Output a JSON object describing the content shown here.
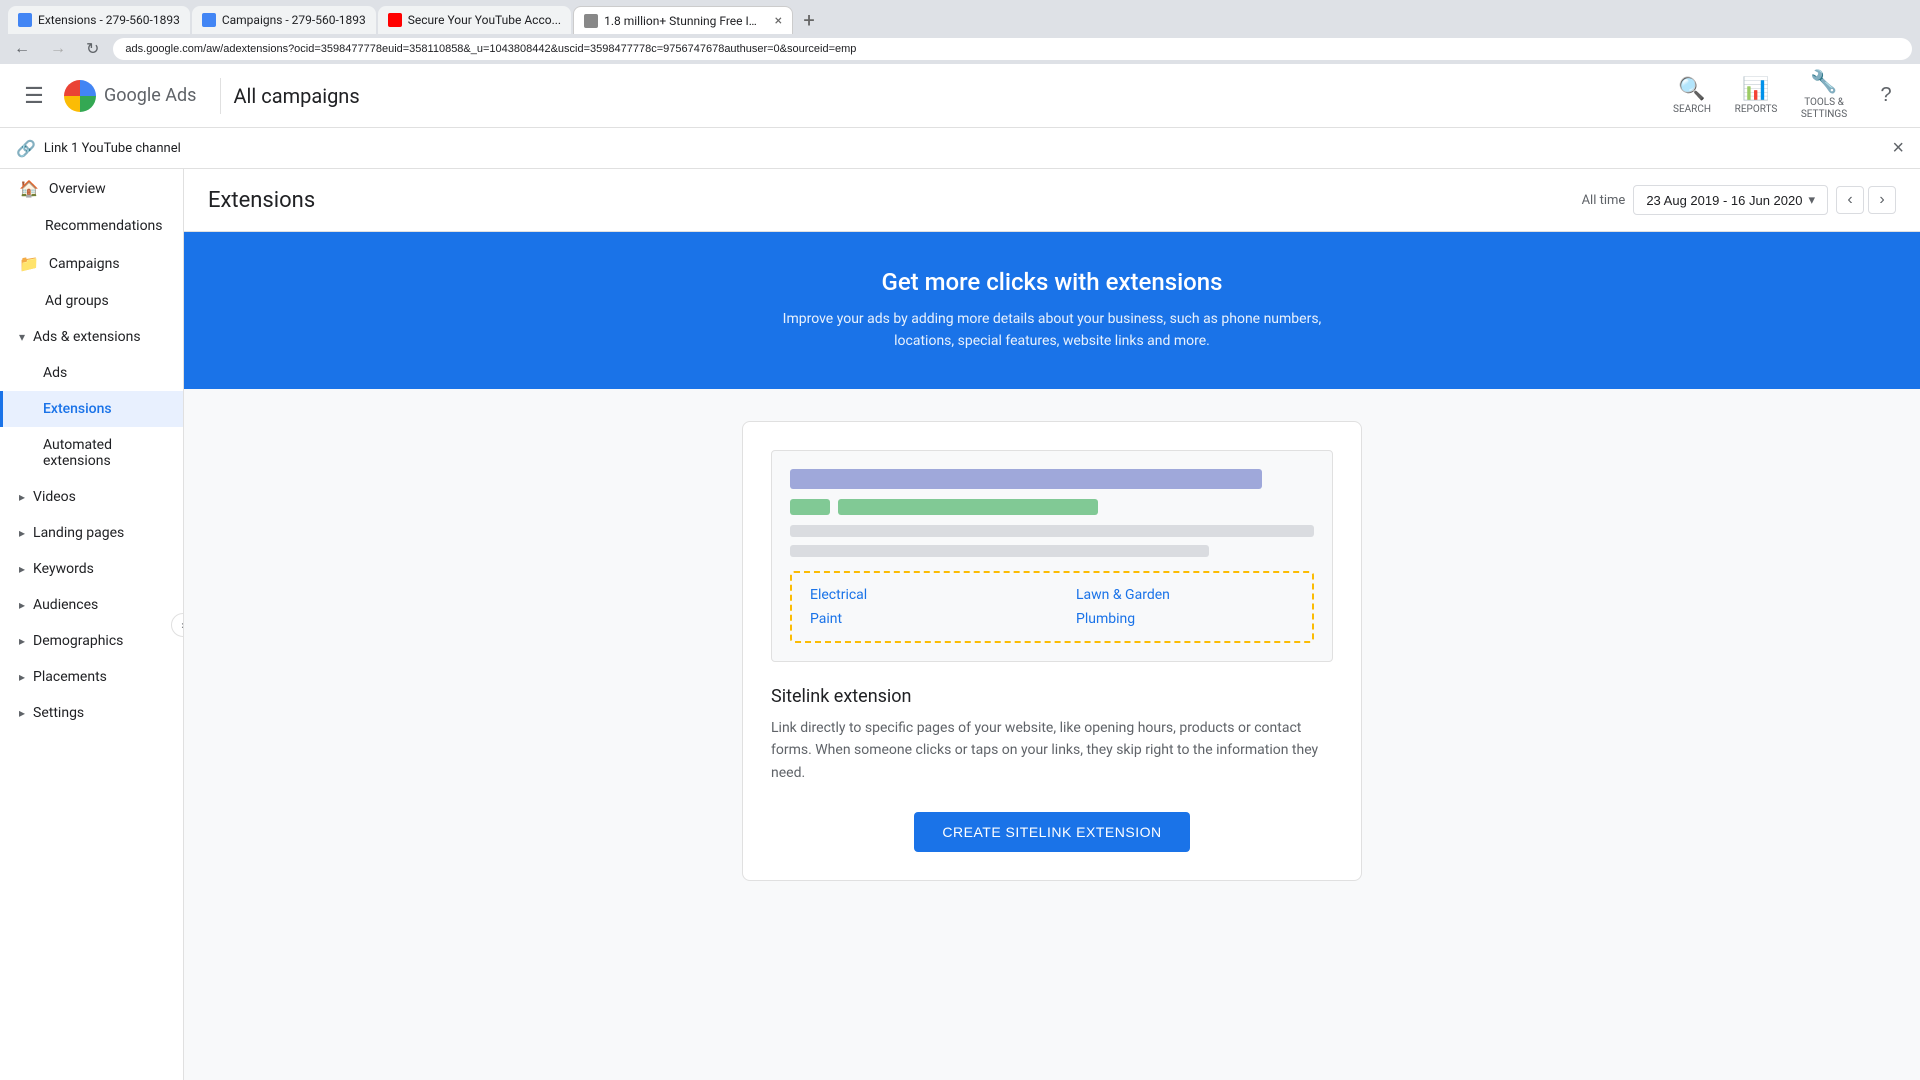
{
  "browser": {
    "address_bar": "ads.google.com/aw/adextensions?ocid=3598477778euid=358110858&_u=1043808442&uscid=3598477778c=9756747678authuser=0&sourceid=emp",
    "tabs": [
      {
        "id": "tab1",
        "label": "Extensions - 279-560-1893",
        "favicon_type": "google-ads",
        "active": false
      },
      {
        "id": "tab2",
        "label": "Campaigns - 279-560-1893",
        "favicon_type": "campaigns",
        "active": false
      },
      {
        "id": "tab3",
        "label": "Secure Your YouTube Acco...",
        "favicon_type": "youtube",
        "active": false
      },
      {
        "id": "tab4",
        "label": "1.8 million+ Stunning Free Im...",
        "favicon_type": "external",
        "active": true
      }
    ]
  },
  "notification_bar": {
    "text": "Link 1 YouTube channel",
    "close_label": "×"
  },
  "header": {
    "app_name": "Google Ads",
    "campaign_label": "All campaigns",
    "search_label": "SEARCH",
    "reports_label": "REPORTS",
    "tools_label": "TOOLS & SETTINGS"
  },
  "sidebar": {
    "items": [
      {
        "id": "overview",
        "label": "Overview",
        "icon": "🏠",
        "has_icon": true,
        "level": "top"
      },
      {
        "id": "recommendations",
        "label": "Recommendations",
        "icon": "",
        "level": "top"
      },
      {
        "id": "campaigns",
        "label": "Campaigns",
        "icon": "🏠",
        "has_icon": true,
        "level": "top"
      },
      {
        "id": "ad-groups",
        "label": "Ad groups",
        "icon": "",
        "level": "top"
      },
      {
        "id": "ads-extensions",
        "label": "Ads & extensions",
        "icon": "",
        "level": "group",
        "expanded": true
      },
      {
        "id": "ads",
        "label": "Ads",
        "icon": "",
        "level": "sub"
      },
      {
        "id": "extensions",
        "label": "Extensions",
        "icon": "",
        "level": "sub",
        "active": true
      },
      {
        "id": "automated-extensions",
        "label": "Automated extensions",
        "icon": "",
        "level": "sub"
      },
      {
        "id": "videos",
        "label": "Videos",
        "icon": "",
        "level": "group"
      },
      {
        "id": "landing-pages",
        "label": "Landing pages",
        "icon": "",
        "level": "group"
      },
      {
        "id": "keywords",
        "label": "Keywords",
        "icon": "",
        "level": "group"
      },
      {
        "id": "audiences",
        "label": "Audiences",
        "icon": "",
        "level": "group"
      },
      {
        "id": "demographics",
        "label": "Demographics",
        "icon": "",
        "level": "group"
      },
      {
        "id": "placements",
        "label": "Placements",
        "icon": "",
        "level": "group"
      },
      {
        "id": "settings",
        "label": "Settings",
        "icon": "",
        "level": "group"
      }
    ]
  },
  "content": {
    "page_title": "Extensions",
    "date_range": {
      "label": "All time",
      "value": "23 Aug 2019 - 16 Jun 2020"
    },
    "promo_banner": {
      "heading": "Get more clicks with extensions",
      "description": "Improve your ads by adding more details about your business, such as phone numbers, locations, special features, website links and more."
    },
    "extension_card": {
      "sitelinks": [
        "Electrical",
        "Lawn & Garden",
        "Paint",
        "Plumbing"
      ],
      "title": "Sitelink extension",
      "description": "Link directly to specific pages of your website, like opening hours, products or contact forms. When someone clicks or taps on your links, they skip right to the information they need.",
      "cta_label": "CREATE SITELINK EXTENSION"
    }
  }
}
